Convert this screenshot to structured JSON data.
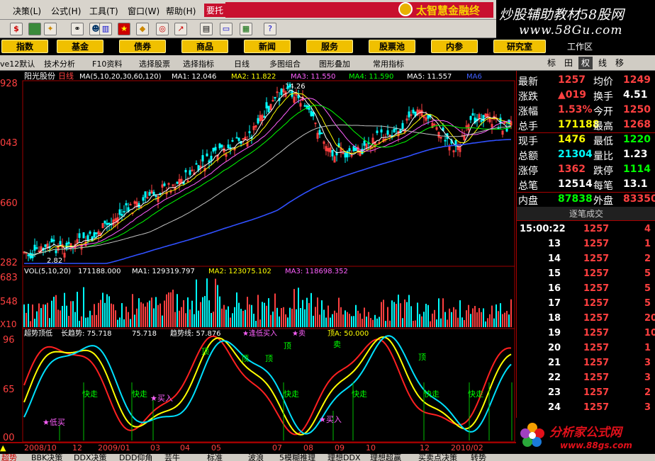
{
  "menu": {
    "items": [
      "决策(L)",
      "公式(H)",
      "工具(T)",
      "窗口(W)",
      "帮助(H)"
    ],
    "active": "要托",
    "brand": "太智慧金融终"
  },
  "watermark_top": {
    "title": "炒股辅助教材58股网",
    "url": "www.58Gu.com"
  },
  "toolbar": {
    "icons": [
      "dollar-icon",
      "flag-icon",
      "puzzle-icon",
      "binoculars-icon",
      "users-icon",
      "chart-icon",
      "flag-cn-icon",
      "diamond-icon",
      "ring-icon",
      "trend-icon",
      "doc-icon",
      "window-icon",
      "grid-icon",
      "help-icon"
    ]
  },
  "nav": {
    "buttons": [
      "指数",
      "基金",
      "债券",
      "商品",
      "新闻",
      "服务",
      "股票池",
      "内参",
      "研究室"
    ],
    "workspace": "工作区"
  },
  "tabs": {
    "items": [
      "ve12默认",
      "技术分析",
      "F10资料",
      "选择股票",
      "选择指标",
      "日线",
      "多图组合",
      "图形叠加",
      "常用指标"
    ]
  },
  "side_tabs": [
    "标",
    "田",
    "权",
    "线",
    "移"
  ],
  "price_chart": {
    "stock": "阳光股份",
    "period": "日线",
    "ma_label": "MA(5,10,20,30,60,120)",
    "ma1": "MA1: 12.046",
    "ma2": "MA2: 11.822",
    "ma3": "MA3: 11.550",
    "ma4": "MA4: 11.590",
    "ma5": "MA5: 11.557",
    "ma6": "MA6",
    "high_label": "14.26",
    "low_label": "2.82",
    "y_labels": [
      "928",
      "043",
      "660",
      "282"
    ]
  },
  "volume_chart": {
    "label": "VOL(5,10,20)",
    "vol": "171188.000",
    "ma1": "MA1: 129319.797",
    "ma2": "MA2: 123075.102",
    "ma3": "MA3: 118698.352",
    "y_labels": [
      "683",
      "548",
      "X10"
    ]
  },
  "indicator_chart": {
    "name": "超势顶低",
    "line1": "长趋势: 75.718",
    "line2": "75.718",
    "line3": "趋势线: 57.876",
    "line4": "★逢低买入",
    "line5": "★卖",
    "line6": "顶A: 50.000",
    "y_labels": [
      "96",
      "65",
      "00"
    ],
    "annotations": [
      "★低买",
      "快走",
      "快走",
      "★买入",
      "顶",
      "顶",
      "顶",
      "快走",
      "★买入",
      "顶",
      "快走",
      "快走",
      "卖",
      "顶",
      "快走"
    ]
  },
  "date_axis": {
    "labels": [
      "2008/10",
      "12",
      "2009/01",
      "03",
      "04",
      "05",
      "07",
      "08",
      "09",
      "10",
      "12",
      "2010/02"
    ]
  },
  "quote": {
    "rows": [
      {
        "l1": "最新",
        "v1": "1257",
        "l2": "均价",
        "v2": "1249",
        "c1": "#ff4040",
        "c2": "#ff4040"
      },
      {
        "l1": "涨跌",
        "v1": "▲019",
        "l2": "换手",
        "v2": "4.51",
        "c1": "#ff4040",
        "c2": "#ffffff"
      },
      {
        "l1": "涨幅",
        "v1": "1.53%",
        "l2": "今开",
        "v2": "1250",
        "c1": "#ff4040",
        "c2": "#ff4040"
      },
      {
        "l1": "总手",
        "v1": "171188",
        "l2": "最高",
        "v2": "1268",
        "c1": "#ffff00",
        "c2": "#ff4040"
      },
      {
        "l1": "现手",
        "v1": "1476",
        "l2": "最低",
        "v2": "1220",
        "c1": "#ffff00",
        "c2": "#00ff00"
      },
      {
        "l1": "总额",
        "v1": "21304",
        "l2": "量比",
        "v2": "1.23",
        "c1": "#00ffff",
        "c2": "#ffffff"
      },
      {
        "l1": "涨停",
        "v1": "1362",
        "l2": "跌停",
        "v2": "1114",
        "c1": "#ff4040",
        "c2": "#00ff00"
      },
      {
        "l1": "总笔",
        "v1": "12514",
        "l2": "每笔",
        "v2": "13.1",
        "c1": "#ffffff",
        "c2": "#ffffff"
      },
      {
        "l1": "内盘",
        "v1": "87838",
        "l2": "外盘",
        "v2": "83350",
        "c1": "#00ff00",
        "c2": "#ff4040"
      }
    ],
    "tick_header": "逐笔成交",
    "ticks": [
      {
        "time": "15:00:22",
        "price": "1257",
        "vol": "4"
      },
      {
        "time": "13",
        "price": "1257",
        "vol": "1"
      },
      {
        "time": "14",
        "price": "1257",
        "vol": "2"
      },
      {
        "time": "15",
        "price": "1257",
        "vol": "5"
      },
      {
        "time": "16",
        "price": "1257",
        "vol": "5"
      },
      {
        "time": "17",
        "price": "1257",
        "vol": "5"
      },
      {
        "time": "18",
        "price": "1257",
        "vol": "20"
      },
      {
        "time": "19",
        "price": "1257",
        "vol": "10"
      },
      {
        "time": "20",
        "price": "1257",
        "vol": "1"
      },
      {
        "time": "21",
        "price": "1257",
        "vol": "3"
      },
      {
        "time": "22",
        "price": "1257",
        "vol": "3"
      },
      {
        "time": "23",
        "price": "1257",
        "vol": "2"
      },
      {
        "time": "24",
        "price": "1257",
        "vol": "3"
      }
    ]
  },
  "watermark_bottom": {
    "title": "分析家公式网",
    "url": "www.88gs.com"
  },
  "bottom_tabs": [
    "超势",
    "BBK决策",
    "DDX决策",
    "DDD仰角",
    "芸牛",
    "标准",
    "波浪",
    "5模糊推理",
    "理想DDX",
    "理想超赢",
    "买卖点决策",
    "转势"
  ]
}
